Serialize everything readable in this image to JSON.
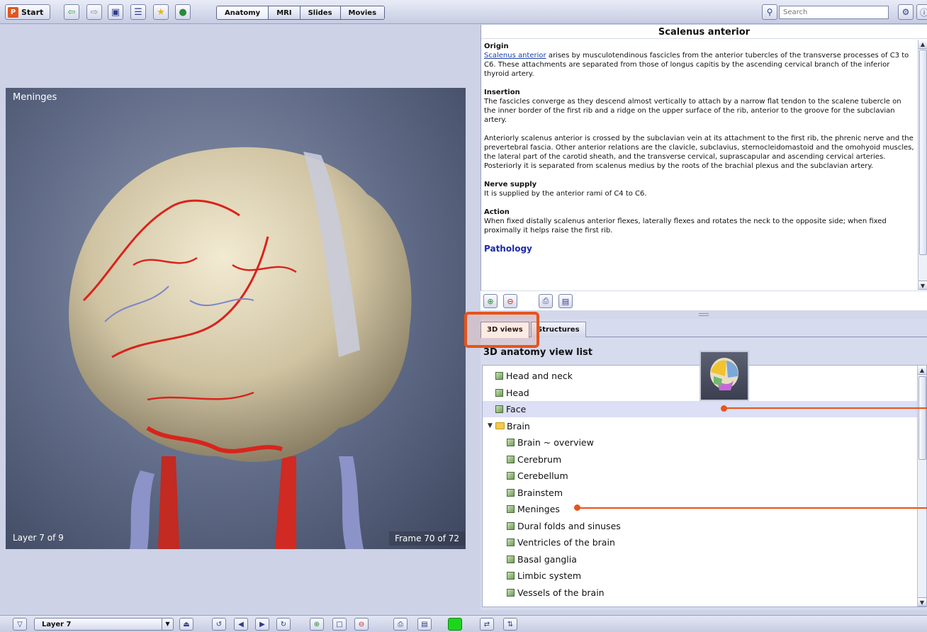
{
  "toolbar": {
    "start_label": "Start",
    "start_logo": "P",
    "tabs": [
      "Anatomy",
      "MRI",
      "Slides",
      "Movies"
    ],
    "search_placeholder": "Search",
    "icons": [
      "back-arrow-icon",
      "forward-arrow-icon",
      "window-icon",
      "list-icon",
      "star-icon",
      "globe-icon",
      "search-icon",
      "settings-icon",
      "info-icon"
    ]
  },
  "viewer": {
    "title": "Meninges",
    "layer_text": "Layer 7 of 9",
    "frame_text": "Frame 70 of 72"
  },
  "article": {
    "title": "Scalenus anterior",
    "origin_heading": "Origin",
    "origin_link": "Scalenus anterior",
    "origin_text": " arises by musculotendinous fascicles from the anterior tubercles of the transverse processes of C3 to C6. These attachments are separated from those of longus capitis by the ascending cervical branch of the inferior thyroid artery.",
    "insertion_heading": "Insertion",
    "insertion_text": "The fascicles converge as they descend almost vertically to attach by a narrow flat tendon to the scalene tubercle on the inner border of the first rib and a ridge on the upper surface of the rib, anterior to the groove for the subclavian artery.",
    "relations_text": "Anteriorly scalenus anterior is crossed by the subclavian vein at its attachment to the first rib, the phrenic nerve and the prevertebral fascia. Other anterior relations are the clavicle, subclavius, sternocleidomastoid and the omohyoid muscles, the lateral part of the carotid sheath, and the transverse cervical, suprascapular and ascending cervical arteries. Posteriorly it is separated from scalenus medius by the roots of the brachial plexus and the subclavian artery.",
    "nerve_heading": "Nerve supply",
    "nerve_text": "It is supplied by the anterior rami of C4 to C6.",
    "action_heading": "Action",
    "action_text": "When fixed distally scalenus anterior flexes, laterally flexes and rotates the neck to the opposite side; when fixed proximally it helps raise the first rib.",
    "pathology_heading": "Pathology"
  },
  "lower": {
    "tabs": [
      "3D views",
      "Structures"
    ],
    "active_tab": "3D views",
    "heading": "3D anatomy view list",
    "items": [
      {
        "label": "Head and neck",
        "type": "leaf",
        "indent": 0
      },
      {
        "label": "Head",
        "type": "leaf",
        "indent": 0
      },
      {
        "label": "Face",
        "type": "leaf",
        "indent": 0,
        "selected": true
      },
      {
        "label": "Brain",
        "type": "folder",
        "indent": 0
      },
      {
        "label": "Brain ~ overview",
        "type": "leaf",
        "indent": 1
      },
      {
        "label": "Cerebrum",
        "type": "leaf",
        "indent": 1
      },
      {
        "label": "Cerebellum",
        "type": "leaf",
        "indent": 1
      },
      {
        "label": "Brainstem",
        "type": "leaf",
        "indent": 1
      },
      {
        "label": "Meninges",
        "type": "leaf",
        "indent": 1
      },
      {
        "label": "Dural folds and sinuses",
        "type": "leaf",
        "indent": 1
      },
      {
        "label": "Ventricles of the brain",
        "type": "leaf",
        "indent": 1
      },
      {
        "label": "Basal ganglia",
        "type": "leaf",
        "indent": 1
      },
      {
        "label": "Limbic system",
        "type": "leaf",
        "indent": 1
      },
      {
        "label": "Vessels of the brain",
        "type": "leaf",
        "indent": 1
      }
    ]
  },
  "bottom": {
    "layer_label": "Layer 7"
  },
  "colors": {
    "accent": "#e8531a",
    "link": "#1a3fb0",
    "pathology": "#1e2aa8"
  }
}
